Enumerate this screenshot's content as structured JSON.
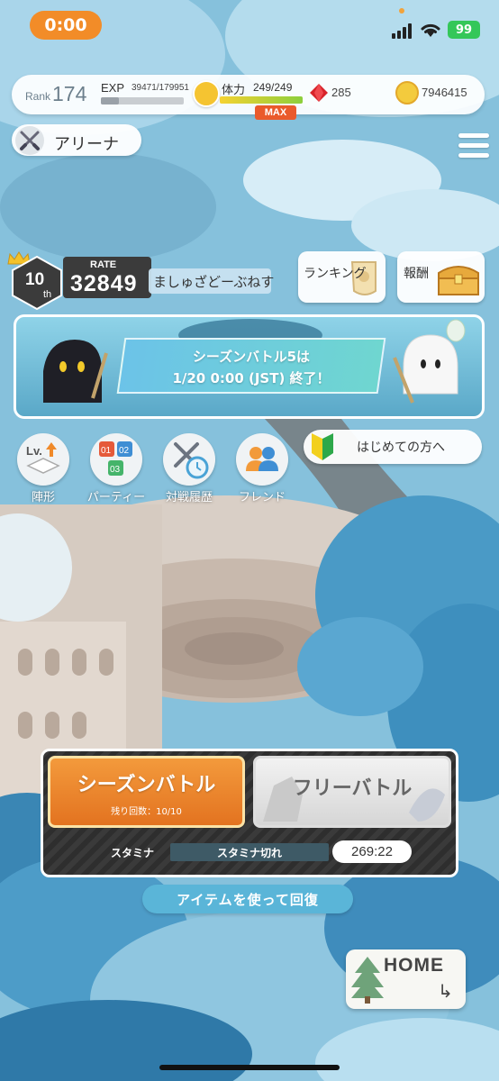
{
  "status_bar": {
    "time": "0:00",
    "battery": "99"
  },
  "player": {
    "rank_label": "Rank",
    "rank": "174",
    "exp_label": "EXP",
    "exp_value": "39471/179951",
    "exp_progress": 0.22,
    "stamina_label": "体力",
    "stamina_value": "249/249",
    "stamina_max_label": "MAX",
    "gems": "285",
    "coins": "7946415"
  },
  "header": {
    "mode_label": "アリーナ"
  },
  "arena": {
    "position": "10",
    "position_suffix": "th",
    "rate_label": "RATE",
    "rate": "32849",
    "player_name": "ましゅざどーぶねす"
  },
  "buttons": {
    "ranking": "ランキング",
    "reward": "報酬",
    "beginner": "はじめての方へ",
    "season_battle": "シーズンバトル",
    "season_remaining": "残り回数：10/10",
    "free_battle": "フリーバトル",
    "recover": "アイテムを使って回復",
    "home": "HOME"
  },
  "banner": {
    "line1": "シーズンバトル5は",
    "line2": "1/20 0:00 (JST) 終了！"
  },
  "shortcuts": [
    {
      "label": "陣形",
      "icon": "formation-icon"
    },
    {
      "label": "パーティー",
      "icon": "party-icon"
    },
    {
      "label": "対戦履歴",
      "icon": "battle-history-icon"
    },
    {
      "label": "フレンド",
      "icon": "friends-icon"
    }
  ],
  "stamina_panel": {
    "label": "スタミナ",
    "empty_text": "スタミナ切れ",
    "timer": "269:22"
  },
  "colors": {
    "accent_orange": "#f28c28",
    "season_button": "#e37320",
    "max_badge": "#ea5a2b",
    "sky_blue": "#7fbad6"
  }
}
